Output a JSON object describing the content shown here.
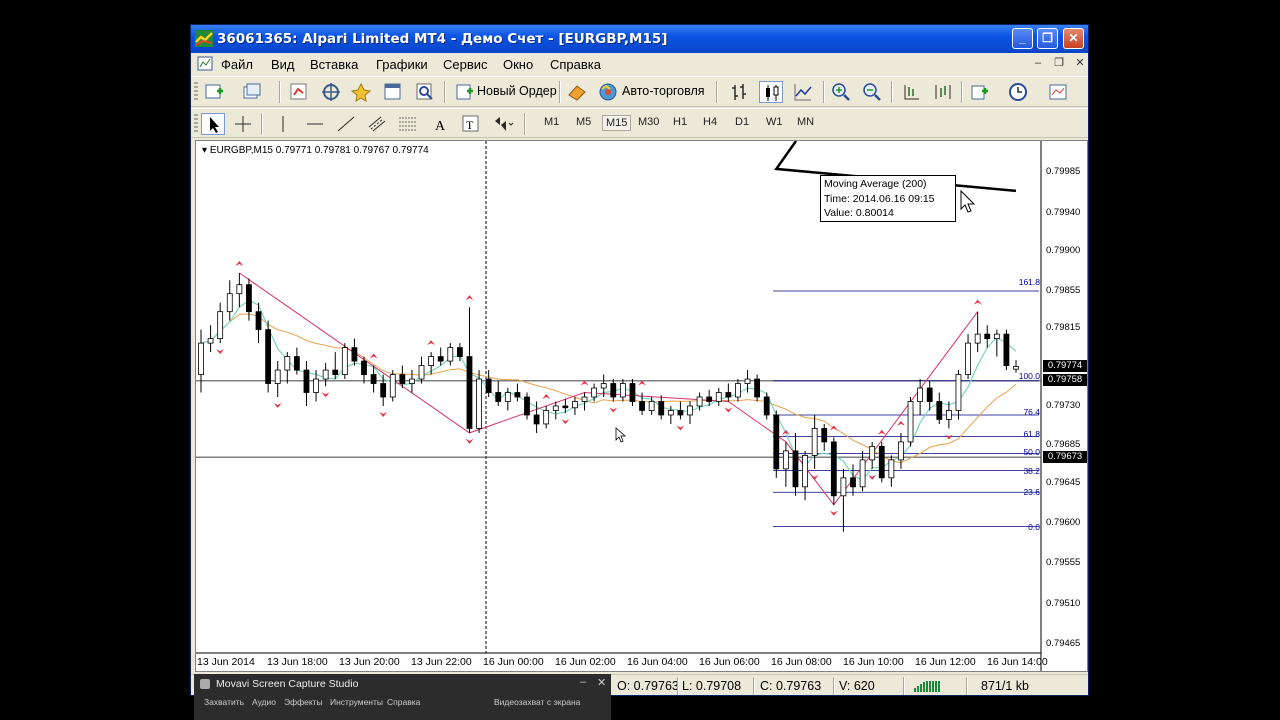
{
  "window": {
    "title": "36061365: Alpari Limited MT4 - Демо Счет - [EURGBP,M15]"
  },
  "menu": {
    "items": [
      "Файл",
      "Вид",
      "Вставка",
      "Графики",
      "Сервис",
      "Окно",
      "Справка"
    ]
  },
  "toolbar": {
    "new_order_label": "Новый Ордер",
    "autotrade_label": "Авто-торговля",
    "timeframes": [
      "M1",
      "M5",
      "M15",
      "M30",
      "H1",
      "H4",
      "D1",
      "W1",
      "MN"
    ],
    "active_timeframe": "M15"
  },
  "chart": {
    "symbol_line": "EURGBP,M15  0.79771 0.79781 0.79767 0.79774",
    "tooltip": {
      "line1": "Moving Average (200)",
      "line2": "Time: 2014.06.16 09:15",
      "line3": "Value: 0.80014"
    },
    "price_labels": {
      "current": "0.79774",
      "level100": "0.79758",
      "level50": "0.79673"
    },
    "fib_labels": [
      "161.8",
      "100.0",
      "76.4",
      "61.8",
      "50.0",
      "38.2",
      "23.6",
      "0.0"
    ]
  },
  "chart_data": {
    "type": "candlestick",
    "symbol": "EURGBP",
    "timeframe": "M15",
    "y_ticks": [
      "0.79985",
      "0.79940",
      "0.79900",
      "0.79855",
      "0.79815",
      "0.79730",
      "0.79685",
      "0.79645",
      "0.79600",
      "0.79555",
      "0.79510",
      "0.79465"
    ],
    "x_ticks": [
      "13 Jun 2014",
      "13 Jun 18:00",
      "13 Jun 20:00",
      "13 Jun 22:00",
      "16 Jun 00:00",
      "16 Jun 02:00",
      "16 Jun 04:00",
      "16 Jun 06:00",
      "16 Jun 08:00",
      "16 Jun 10:00",
      "16 Jun 12:00",
      "16 Jun 14:00"
    ],
    "ylim": [
      0.79455,
      0.80025
    ],
    "candles": [
      {
        "o": 0.79765,
        "h": 0.79815,
        "l": 0.79745,
        "c": 0.798
      },
      {
        "o": 0.798,
        "h": 0.7982,
        "l": 0.7979,
        "c": 0.79805
      },
      {
        "o": 0.79805,
        "h": 0.79845,
        "l": 0.798,
        "c": 0.79835
      },
      {
        "o": 0.79835,
        "h": 0.7987,
        "l": 0.79825,
        "c": 0.79855
      },
      {
        "o": 0.79855,
        "h": 0.79878,
        "l": 0.7984,
        "c": 0.79865
      },
      {
        "o": 0.79865,
        "h": 0.79872,
        "l": 0.79825,
        "c": 0.79835
      },
      {
        "o": 0.79835,
        "h": 0.79845,
        "l": 0.798,
        "c": 0.79815
      },
      {
        "o": 0.79815,
        "h": 0.79825,
        "l": 0.79745,
        "c": 0.79755
      },
      {
        "o": 0.79755,
        "h": 0.7978,
        "l": 0.7974,
        "c": 0.7977
      },
      {
        "o": 0.7977,
        "h": 0.7979,
        "l": 0.79755,
        "c": 0.79785
      },
      {
        "o": 0.79785,
        "h": 0.79795,
        "l": 0.79765,
        "c": 0.7977
      },
      {
        "o": 0.7977,
        "h": 0.7978,
        "l": 0.7973,
        "c": 0.79745
      },
      {
        "o": 0.79745,
        "h": 0.7977,
        "l": 0.79735,
        "c": 0.7976
      },
      {
        "o": 0.7976,
        "h": 0.79778,
        "l": 0.79752,
        "c": 0.7977
      },
      {
        "o": 0.7977,
        "h": 0.7979,
        "l": 0.7976,
        "c": 0.79765
      },
      {
        "o": 0.79765,
        "h": 0.798,
        "l": 0.7976,
        "c": 0.79795
      },
      {
        "o": 0.79795,
        "h": 0.79805,
        "l": 0.79775,
        "c": 0.7978
      },
      {
        "o": 0.7978,
        "h": 0.79785,
        "l": 0.79755,
        "c": 0.79765
      },
      {
        "o": 0.79765,
        "h": 0.79775,
        "l": 0.79745,
        "c": 0.79755
      },
      {
        "o": 0.79755,
        "h": 0.79765,
        "l": 0.7973,
        "c": 0.7974
      },
      {
        "o": 0.7974,
        "h": 0.7977,
        "l": 0.79735,
        "c": 0.79765
      },
      {
        "o": 0.79765,
        "h": 0.79775,
        "l": 0.7975,
        "c": 0.79755
      },
      {
        "o": 0.79755,
        "h": 0.7977,
        "l": 0.79745,
        "c": 0.7976
      },
      {
        "o": 0.7976,
        "h": 0.79785,
        "l": 0.79755,
        "c": 0.79775
      },
      {
        "o": 0.79775,
        "h": 0.7979,
        "l": 0.79765,
        "c": 0.79785
      },
      {
        "o": 0.79785,
        "h": 0.79795,
        "l": 0.79775,
        "c": 0.7978
      },
      {
        "o": 0.7978,
        "h": 0.798,
        "l": 0.79775,
        "c": 0.79795
      },
      {
        "o": 0.79795,
        "h": 0.798,
        "l": 0.7978,
        "c": 0.79785
      },
      {
        "o": 0.79785,
        "h": 0.7984,
        "l": 0.797,
        "c": 0.79705
      },
      {
        "o": 0.79705,
        "h": 0.7977,
        "l": 0.797,
        "c": 0.7976
      },
      {
        "o": 0.7976,
        "h": 0.7977,
        "l": 0.7974,
        "c": 0.79745
      },
      {
        "o": 0.79745,
        "h": 0.79758,
        "l": 0.7973,
        "c": 0.79735
      },
      {
        "o": 0.79735,
        "h": 0.7975,
        "l": 0.79725,
        "c": 0.79745
      },
      {
        "o": 0.79745,
        "h": 0.79755,
        "l": 0.79735,
        "c": 0.7974
      },
      {
        "o": 0.7974,
        "h": 0.79745,
        "l": 0.79715,
        "c": 0.7972
      },
      {
        "o": 0.7972,
        "h": 0.79735,
        "l": 0.797,
        "c": 0.7971
      },
      {
        "o": 0.7971,
        "h": 0.7973,
        "l": 0.79705,
        "c": 0.79725
      },
      {
        "o": 0.79725,
        "h": 0.79735,
        "l": 0.79715,
        "c": 0.7973
      },
      {
        "o": 0.7973,
        "h": 0.79738,
        "l": 0.79722,
        "c": 0.79728
      },
      {
        "o": 0.79728,
        "h": 0.7974,
        "l": 0.7972,
        "c": 0.79735
      },
      {
        "o": 0.79735,
        "h": 0.79745,
        "l": 0.79725,
        "c": 0.7974
      },
      {
        "o": 0.7974,
        "h": 0.79755,
        "l": 0.79735,
        "c": 0.7975
      },
      {
        "o": 0.7975,
        "h": 0.79765,
        "l": 0.7974,
        "c": 0.79755
      },
      {
        "o": 0.79755,
        "h": 0.7976,
        "l": 0.79735,
        "c": 0.7974
      },
      {
        "o": 0.7974,
        "h": 0.7976,
        "l": 0.79735,
        "c": 0.79755
      },
      {
        "o": 0.79755,
        "h": 0.7976,
        "l": 0.7973,
        "c": 0.79735
      },
      {
        "o": 0.79735,
        "h": 0.79745,
        "l": 0.7972,
        "c": 0.79725
      },
      {
        "o": 0.79725,
        "h": 0.7974,
        "l": 0.7972,
        "c": 0.79735
      },
      {
        "o": 0.79735,
        "h": 0.79742,
        "l": 0.79715,
        "c": 0.7972
      },
      {
        "o": 0.7972,
        "h": 0.7973,
        "l": 0.7971,
        "c": 0.79725
      },
      {
        "o": 0.79725,
        "h": 0.79735,
        "l": 0.79715,
        "c": 0.7972
      },
      {
        "o": 0.7972,
        "h": 0.79735,
        "l": 0.7971,
        "c": 0.7973
      },
      {
        "o": 0.7973,
        "h": 0.79745,
        "l": 0.79725,
        "c": 0.7974
      },
      {
        "o": 0.7974,
        "h": 0.79748,
        "l": 0.7973,
        "c": 0.79735
      },
      {
        "o": 0.79735,
        "h": 0.7975,
        "l": 0.7973,
        "c": 0.79745
      },
      {
        "o": 0.79745,
        "h": 0.79755,
        "l": 0.79735,
        "c": 0.7974
      },
      {
        "o": 0.7974,
        "h": 0.7976,
        "l": 0.79735,
        "c": 0.79755
      },
      {
        "o": 0.79755,
        "h": 0.7977,
        "l": 0.79745,
        "c": 0.7976
      },
      {
        "o": 0.7976,
        "h": 0.79765,
        "l": 0.79735,
        "c": 0.7974
      },
      {
        "o": 0.7974,
        "h": 0.79745,
        "l": 0.79715,
        "c": 0.7972
      },
      {
        "o": 0.7972,
        "h": 0.79725,
        "l": 0.7965,
        "c": 0.7966
      },
      {
        "o": 0.7966,
        "h": 0.7969,
        "l": 0.7964,
        "c": 0.7968
      },
      {
        "o": 0.7968,
        "h": 0.797,
        "l": 0.7963,
        "c": 0.7964
      },
      {
        "o": 0.7964,
        "h": 0.7968,
        "l": 0.79625,
        "c": 0.79675
      },
      {
        "o": 0.79675,
        "h": 0.7972,
        "l": 0.7966,
        "c": 0.79705
      },
      {
        "o": 0.79705,
        "h": 0.7971,
        "l": 0.7968,
        "c": 0.7969
      },
      {
        "o": 0.7969,
        "h": 0.79695,
        "l": 0.7962,
        "c": 0.7963
      },
      {
        "o": 0.7963,
        "h": 0.7966,
        "l": 0.7959,
        "c": 0.7965
      },
      {
        "o": 0.7965,
        "h": 0.79665,
        "l": 0.7963,
        "c": 0.7964
      },
      {
        "o": 0.7964,
        "h": 0.7968,
        "l": 0.79635,
        "c": 0.7967
      },
      {
        "o": 0.7967,
        "h": 0.7969,
        "l": 0.7966,
        "c": 0.79685
      },
      {
        "o": 0.79685,
        "h": 0.7969,
        "l": 0.79645,
        "c": 0.7965
      },
      {
        "o": 0.7965,
        "h": 0.79675,
        "l": 0.7964,
        "c": 0.7967
      },
      {
        "o": 0.7967,
        "h": 0.797,
        "l": 0.7966,
        "c": 0.7969
      },
      {
        "o": 0.7969,
        "h": 0.7974,
        "l": 0.79685,
        "c": 0.79735
      },
      {
        "o": 0.79735,
        "h": 0.7976,
        "l": 0.7972,
        "c": 0.7975
      },
      {
        "o": 0.7975,
        "h": 0.79758,
        "l": 0.79725,
        "c": 0.79735
      },
      {
        "o": 0.79735,
        "h": 0.79745,
        "l": 0.7971,
        "c": 0.79715
      },
      {
        "o": 0.79715,
        "h": 0.79735,
        "l": 0.79705,
        "c": 0.79725
      },
      {
        "o": 0.79725,
        "h": 0.7977,
        "l": 0.79715,
        "c": 0.79765
      },
      {
        "o": 0.79765,
        "h": 0.7981,
        "l": 0.7976,
        "c": 0.798
      },
      {
        "o": 0.798,
        "h": 0.79835,
        "l": 0.7979,
        "c": 0.7981
      },
      {
        "o": 0.7981,
        "h": 0.7982,
        "l": 0.79795,
        "c": 0.79805
      },
      {
        "o": 0.79805,
        "h": 0.79815,
        "l": 0.79785,
        "c": 0.7981
      },
      {
        "o": 0.7981,
        "h": 0.79815,
        "l": 0.7977,
        "c": 0.79775
      },
      {
        "o": 0.79771,
        "h": 0.79781,
        "l": 0.79767,
        "c": 0.79774
      }
    ],
    "horizontal_lines": [
      0.79758,
      0.79673
    ],
    "fibonacci": [
      {
        "level": "161.8",
        "price": 0.79858
      },
      {
        "level": "100.0",
        "price": 0.79758
      },
      {
        "level": "76.4",
        "price": 0.7972
      },
      {
        "level": "61.8",
        "price": 0.79696
      },
      {
        "level": "50.0",
        "price": 0.79677
      },
      {
        "level": "38.2",
        "price": 0.79658
      },
      {
        "level": "23.6",
        "price": 0.79634
      },
      {
        "level": "0.0",
        "price": 0.79596
      }
    ],
    "moving_average_200": {
      "name": "Moving Average (200)",
      "time": "2014.06.16 09:15",
      "value": 0.80014
    },
    "colors": {
      "ma_fast": "#7ad3c0",
      "ma_slow": "#e8a24a",
      "zigzag": "#d8326a",
      "fib": "#000080",
      "ma200": "#000000"
    }
  },
  "statusbar": {
    "open": "O: 0.79763",
    "low": "L: 0.79708",
    "close": "C: 0.79763",
    "volume": "V: 620",
    "traffic": "871/1 kb"
  },
  "movavi": {
    "title": "Movavi Screen Capture Studio",
    "menu": [
      "Захватить",
      "Аудио",
      "Эффекты",
      "Инструменты",
      "Справка"
    ],
    "capture_label": "Видеозахват с экрана"
  }
}
